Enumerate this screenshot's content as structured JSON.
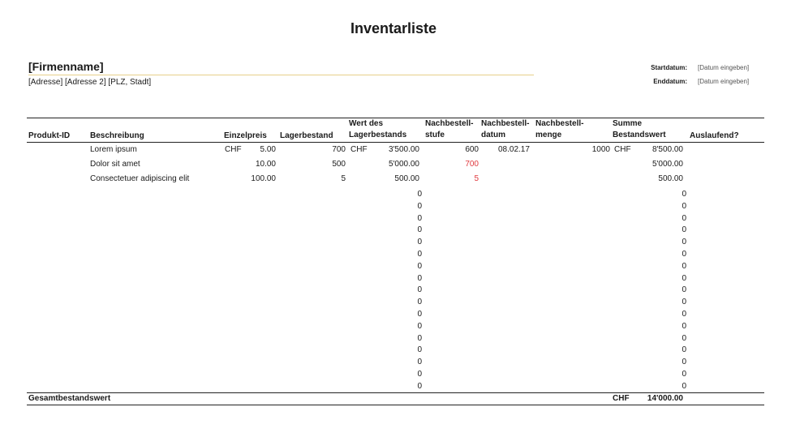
{
  "title": "Inventarliste",
  "company": {
    "name": "[Firmenname]",
    "address": "[Adresse] [Adresse 2] [PLZ, Stadt]"
  },
  "dates": {
    "start_label": "Startdatum:",
    "start_value": "[Datum eingeben]",
    "end_label": "Enddatum:",
    "end_value": "[Datum eingeben]"
  },
  "table": {
    "headers": {
      "id": "Produkt-ID",
      "desc": "Beschreibung",
      "price": "Einzelpreis",
      "stock": "Lagerbestand",
      "value_1": "Wert des",
      "value_2": "Lagerbestands",
      "reorder_1": "Nachbestell-",
      "reorder_2": "stufe",
      "reorder_date_1": "Nachbestell-",
      "reorder_date_2": "datum",
      "reorder_qty_1": "Nachbestell-",
      "reorder_qty_2": "menge",
      "sum_1": "Summe",
      "sum_2": "Bestandswert",
      "discontinued": "Auslaufend?"
    },
    "rows": [
      {
        "desc": "Lorem ipsum",
        "price_cur": "CHF",
        "price": "5.00",
        "stock": "700",
        "value_cur": "CHF",
        "value": "3'500.00",
        "reorder": "600",
        "reorder_date": "08.02.17",
        "reorder_qty": "1000",
        "sum_cur": "CHF",
        "sum": "8'500.00"
      },
      {
        "desc": "Dolor sit amet",
        "price": "10.00",
        "stock": "500",
        "value": "5'000.00",
        "reorder": "700",
        "sum": "5'000.00"
      },
      {
        "desc": "Consectetuer adipiscing elit",
        "price": "100.00",
        "stock": "5",
        "value": "500.00",
        "reorder": "5",
        "sum": "500.00"
      }
    ],
    "empty_value": "0",
    "empty_rows": 17
  },
  "footer": {
    "label": "Gesamtbestandswert",
    "currency": "CHF",
    "total": "14'000.00"
  },
  "colors": {
    "accent_line": "#e6cf8a",
    "alert_red": "#e0393e"
  }
}
